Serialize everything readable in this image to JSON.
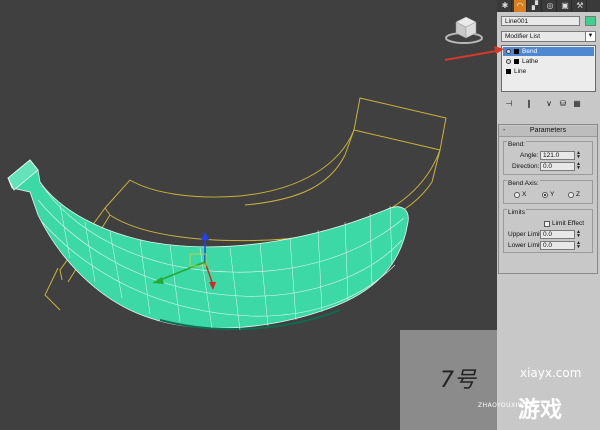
{
  "panel": {
    "tabs": [
      {
        "icon": "create-icon",
        "glyph": "✱"
      },
      {
        "icon": "modify-icon",
        "glyph": "◠"
      },
      {
        "icon": "hierarchy-icon",
        "glyph": "▞"
      },
      {
        "icon": "motion-icon",
        "glyph": "◎"
      },
      {
        "icon": "display-icon",
        "glyph": "▣"
      },
      {
        "icon": "utilities-icon",
        "glyph": "⚒"
      }
    ],
    "object_name": "Line001",
    "object_color": "#3fcf8e",
    "modifier_list_label": "Modifier List",
    "stack": [
      {
        "label": "Bend",
        "selected": true
      },
      {
        "label": "Lathe",
        "selected": false
      },
      {
        "label": "Line",
        "selected": false
      }
    ],
    "stack_tools": [
      "pin-stack-icon",
      "show-end-result-icon",
      "make-unique-icon",
      "remove-modifier-icon",
      "configure-sets-icon"
    ]
  },
  "parameters": {
    "title": "Parameters",
    "collapse_glyph": "-",
    "bend_group": "Bend:",
    "angle_label": "Angle:",
    "angle_value": "121.0",
    "direction_label": "Direction:",
    "direction_value": "0.0",
    "bend_axis_group": "Bend Axis:",
    "axes": [
      {
        "label": "X",
        "selected": false
      },
      {
        "label": "Y",
        "selected": true
      },
      {
        "label": "Z",
        "selected": false
      }
    ],
    "limits_group": "Limits",
    "limit_effect_label": "Limit Effect",
    "limit_effect_checked": false,
    "upper_limit_label": "Upper Limit:",
    "upper_limit_value": "0.0",
    "lower_limit_label": "Lower Limit:",
    "lower_limit_value": "0.0"
  },
  "colors": {
    "selection_accent": "#4d88d0",
    "active_tab": "#d88020",
    "mesh": "#3cd9a7",
    "gizmo": "#c8b43a",
    "annotation_arrow": "#d33a2a"
  },
  "watermark": {
    "logo_glyph": "7号",
    "site": "xiayx.com",
    "brand_pinyin": "ZHAOYOUXIWANG",
    "brand_cn": "游戏"
  }
}
